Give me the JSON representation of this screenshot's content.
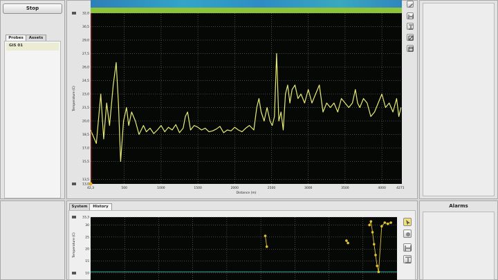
{
  "left": {
    "stop_label": "Stop",
    "tabs": [
      {
        "label": "Probes"
      },
      {
        "label": "Assets"
      }
    ],
    "asset_item": "GIS 01"
  },
  "right": {
    "alarms_title": "Alarms"
  },
  "bottom_tabs": [
    {
      "label": "System"
    },
    {
      "label": "History"
    }
  ],
  "icons": {
    "tools_top": [
      "pencil-icon",
      "fit-horizontal-icon",
      "fit-vertical-icon",
      "zoom-icon",
      "window-icon"
    ],
    "tools_bottom": [
      "cursor-icon",
      "pencil-icon",
      "fit-horizontal-icon",
      "fit-vertical-icon"
    ]
  },
  "colors": {
    "plot_bg": "#060806",
    "trace": "#e8ec72",
    "grid": "#8a8a8a",
    "history_points": "#e0c238"
  },
  "chart_data": [
    {
      "type": "line",
      "xlabel": "Distance (m)",
      "ylabel": "Temperature (C)",
      "x_ticks": [
        "42,3",
        "500",
        "1000",
        "1500",
        "2000",
        "2500",
        "3000",
        "3500",
        "4000",
        "4271,6"
      ],
      "y_ticks": [
        "13,0",
        "13,5",
        "15,5",
        "17,0",
        "18,5",
        "20,0",
        "21,5",
        "23,0",
        "24,5",
        "26,0",
        "27,5",
        "29,0",
        "30,5",
        "32,0"
      ],
      "xlim": [
        42.3,
        4271.6
      ],
      "ylim": [
        13.0,
        32.0
      ],
      "grid": true,
      "series": [
        {
          "x": [
            42,
            120,
            180,
            220,
            260,
            300,
            350,
            390,
            420,
            450,
            490,
            530,
            560,
            600,
            650,
            700,
            760,
            800,
            850,
            900,
            950,
            1000,
            1050,
            1100,
            1150,
            1200,
            1250,
            1300,
            1330,
            1360,
            1400,
            1450,
            1500,
            1550,
            1600,
            1650,
            1700,
            1750,
            1800,
            1850,
            1900,
            1950,
            2000,
            2050,
            2100,
            2150,
            2200,
            2260,
            2300,
            2330,
            2360,
            2400,
            2440,
            2480,
            2510,
            2540,
            2570,
            2600,
            2630,
            2660,
            2690,
            2720,
            2750,
            2780,
            2820,
            2860,
            2900,
            2950,
            3000,
            3050,
            3100,
            3150,
            3200,
            3250,
            3300,
            3350,
            3400,
            3450,
            3500,
            3550,
            3600,
            3640,
            3670,
            3700,
            3750,
            3800,
            3850,
            3900,
            3950,
            4000,
            4050,
            4100,
            4150,
            4200,
            4230,
            4260
          ],
          "y": [
            19.0,
            17.5,
            23.0,
            18.0,
            22.0,
            19.5,
            24.0,
            26.5,
            22.0,
            15.5,
            20.0,
            21.5,
            19.5,
            21.0,
            20.0,
            18.5,
            19.5,
            18.8,
            19.2,
            18.6,
            19.0,
            19.5,
            18.8,
            19.3,
            19.0,
            19.6,
            18.7,
            19.2,
            20.5,
            21.0,
            19.0,
            19.5,
            19.3,
            19.0,
            19.2,
            18.8,
            18.9,
            19.1,
            19.4,
            18.7,
            19.0,
            18.9,
            19.3,
            19.0,
            18.8,
            19.2,
            19.5,
            19.0,
            21.5,
            22.5,
            21.0,
            20.0,
            21.5,
            20.0,
            19.5,
            20.5,
            27.5,
            20.0,
            21.0,
            19.0,
            23.0,
            24.0,
            22.0,
            23.5,
            24.0,
            22.5,
            23.0,
            22.0,
            23.5,
            22.0,
            23.0,
            24.0,
            21.0,
            22.0,
            21.5,
            22.0,
            21.0,
            22.5,
            22.0,
            21.5,
            22.0,
            23.5,
            22.0,
            21.5,
            22.5,
            22.0,
            20.5,
            21.0,
            22.0,
            23.0,
            21.5,
            22.0,
            21.0,
            22.5,
            20.5,
            21.5
          ]
        }
      ]
    },
    {
      "type": "scatter",
      "xlabel": "",
      "ylabel": "Temperature (C)",
      "y_ticks": [
        "10",
        "15",
        "20",
        "25",
        "30",
        "33,3"
      ],
      "ylim": [
        10,
        33.3
      ],
      "grid": true,
      "series": [
        {
          "x": [
            0.57,
            0.575,
            0.835,
            0.84,
            0.91,
            0.915,
            0.92,
            0.925,
            0.93,
            0.935,
            0.94,
            0.95,
            0.96,
            0.97,
            0.98
          ],
          "y": [
            25.5,
            21.0,
            23.5,
            22.5,
            30.0,
            31.5,
            27.0,
            22.0,
            17.5,
            13.0,
            10.5,
            29.5,
            31.0,
            30.5,
            31.0
          ]
        }
      ]
    }
  ]
}
